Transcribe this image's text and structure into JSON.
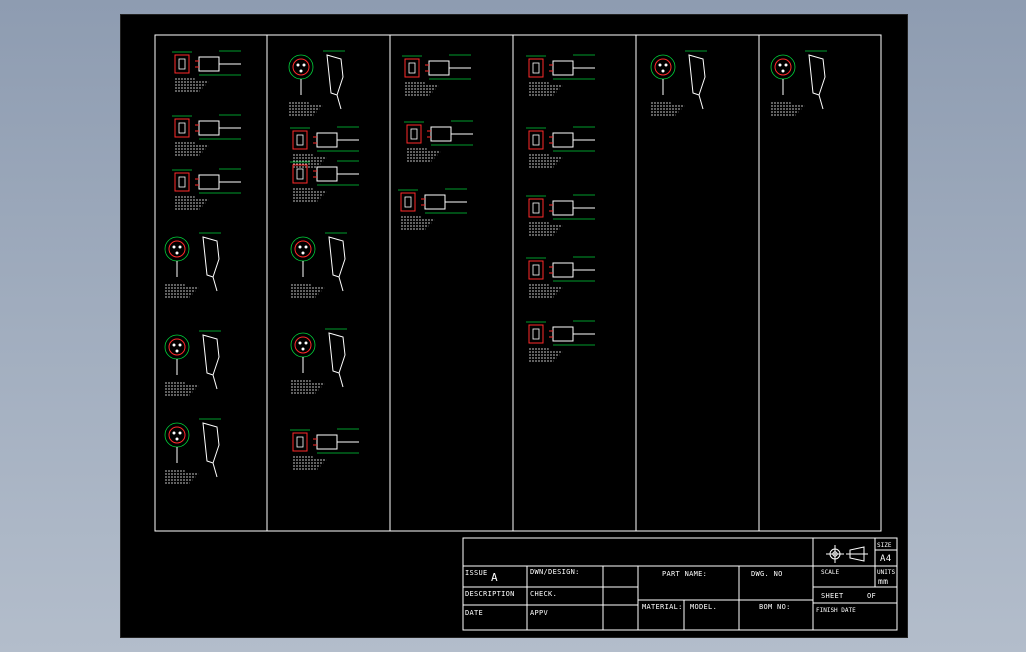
{
  "colors": {
    "background": "#000000",
    "line": "#ffffff",
    "part": "#ff2a2a",
    "dimension": "#00d23a",
    "viewport": "#a3afc0"
  },
  "title_block": {
    "issue_label": "ISSUE",
    "issue_value": "A",
    "dwn_design_label": "DWN/DESIGN:",
    "check_label": "CHECK.",
    "appv_label": "APPV",
    "description_label": "DESCRIPTION",
    "date_label": "DATE",
    "part_name_label": "PART NAME:",
    "dwg_no_label": "DWG. NO",
    "material_label": "MATERIAL:",
    "model_label": "MODEL.",
    "bom_no_label": "BOM NO:",
    "scale_label": "SCALE",
    "size_label": "SIZE",
    "size_value": "A4",
    "units_label": "UNITS",
    "units_value": "mm",
    "sheet_label": "SHEET",
    "of_label": "OF",
    "finish_date_label": "FINISH DATE",
    "projection_icon": "third-angle-projection-icon"
  }
}
